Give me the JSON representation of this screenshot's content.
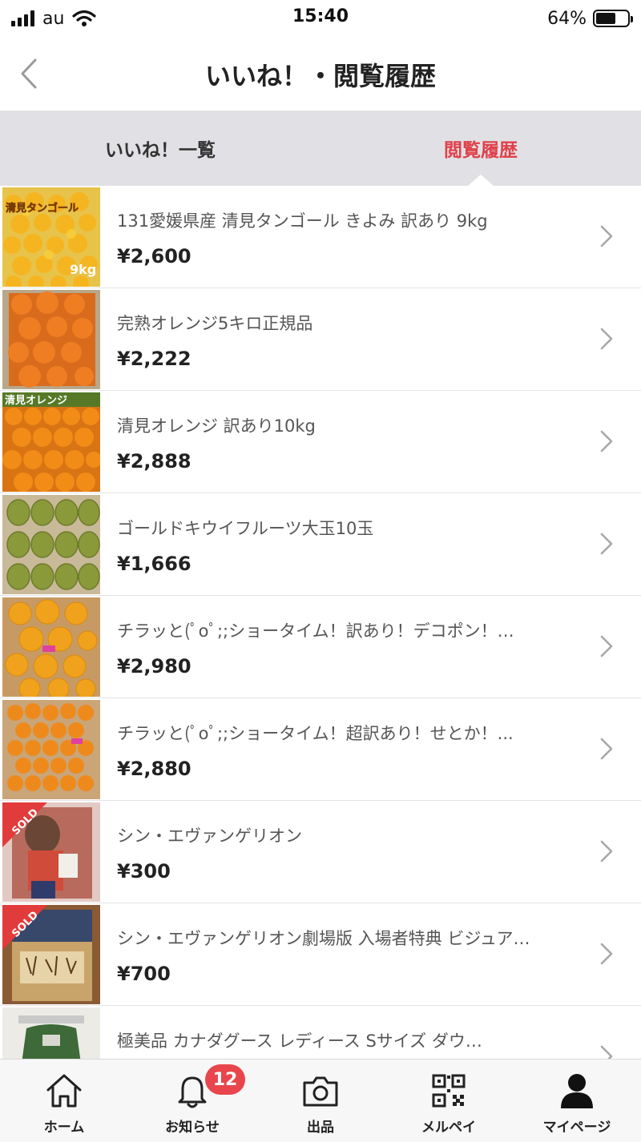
{
  "status_bar": {
    "carrier": "au",
    "time": "15:40",
    "battery_percent": "64%",
    "battery_level": 0.64
  },
  "header": {
    "title": "いいね！・閲覧履歴"
  },
  "tabs": [
    {
      "label": "いいね！一覧",
      "active": false
    },
    {
      "label": "閲覧履歴",
      "active": true
    }
  ],
  "items": [
    {
      "title": "131愛媛県産 清見タンゴール きよみ 訳あり 9kg",
      "price": "¥2,600",
      "thumb_text": "清見タンゴール",
      "thumb_tag": "9kg"
    },
    {
      "title": "完熟オレンジ5キロ正規品",
      "price": "¥2,222"
    },
    {
      "title": "清見オレンジ 訳あり10kg",
      "price": "¥2,888",
      "thumb_text": "清見オレンジ"
    },
    {
      "title": "ゴールドキウイフルーツ大玉10玉",
      "price": "¥1,666"
    },
    {
      "title": "チラッと(ﾟoﾟ;;ショータイム！訳あり！デコポン！…",
      "price": "¥2,980"
    },
    {
      "title": "チラッと(ﾟoﾟ;;ショータイム！超訳あり！せとか！...",
      "price": "¥2,880"
    },
    {
      "title": "シン・エヴァンゲリオン",
      "price": "¥300",
      "sold_label": "SOLD"
    },
    {
      "title": "シン・エヴァンゲリオン劇場版 入場者特典 ビジュア…",
      "price": "¥700",
      "sold_label": "SOLD"
    },
    {
      "title": "極美品 カナダグース レディース Sサイズ ダウ…",
      "price": ""
    }
  ],
  "bottom_nav": [
    {
      "label": "ホーム",
      "icon": "home-icon"
    },
    {
      "label": "お知らせ",
      "icon": "bell-icon",
      "badge": "12"
    },
    {
      "label": "出品",
      "icon": "camera-icon"
    },
    {
      "label": "メルペイ",
      "icon": "qr-code-icon"
    },
    {
      "label": "マイページ",
      "icon": "person-icon"
    }
  ],
  "colors": {
    "accent": "#e0404a",
    "tab_bar": "#e1e1e5",
    "badge": "#e8464c"
  }
}
